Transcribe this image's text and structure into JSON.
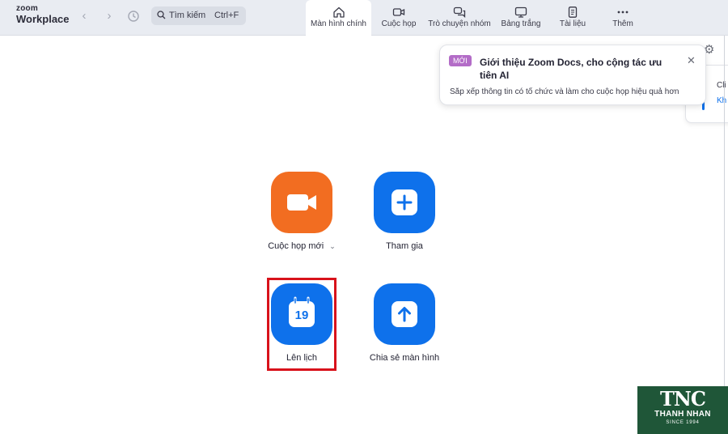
{
  "app": {
    "logo_top": "zoom",
    "logo_bottom": "Workplace"
  },
  "search": {
    "placeholder": "Tìm kiếm",
    "shortcut": "Ctrl+F"
  },
  "tabs": [
    {
      "label": "Màn hình chính",
      "icon": "home-icon",
      "active": true
    },
    {
      "label": "Cuộc họp",
      "icon": "video-icon",
      "active": false
    },
    {
      "label": "Trò chuyện nhóm",
      "icon": "chat-icon",
      "active": false
    },
    {
      "label": "Bảng trắng",
      "icon": "whiteboard-icon",
      "active": false
    },
    {
      "label": "Tài liệu",
      "icon": "document-icon",
      "active": false
    },
    {
      "label": "Thêm",
      "icon": "more-icon",
      "active": false
    }
  ],
  "popup": {
    "badge": "MỚI",
    "title": "Giới thiệu Zoom Docs, cho cộng tác ưu tiên AI",
    "description": "Sắp xếp thông tin có tổ chức và làm cho cuộc họp hiệu quả hơn"
  },
  "side_panel": {
    "line1": "Cli",
    "line2": "Kh"
  },
  "actions": [
    {
      "label": "Cuộc họp mới",
      "icon": "video-camera-icon",
      "color": "#f26d21",
      "has_dropdown": true
    },
    {
      "label": "Tham gia",
      "icon": "plus-icon",
      "color": "#0e71eb",
      "has_dropdown": false
    },
    {
      "label": "Lên lịch",
      "icon": "calendar-icon",
      "calendar_day": "19",
      "color": "#0e71eb",
      "has_dropdown": false,
      "highlighted": true
    },
    {
      "label": "Chia sẻ màn hình",
      "icon": "share-screen-icon",
      "color": "#0e71eb",
      "has_dropdown": false
    }
  ],
  "watermark": {
    "logo": "TNC",
    "name": "THANH NHAN",
    "since": "SINCE 1994"
  },
  "colors": {
    "accent": "#0e71eb",
    "orange": "#f26d21",
    "highlight": "#d8121b",
    "watermark_bg": "#1f5638"
  }
}
